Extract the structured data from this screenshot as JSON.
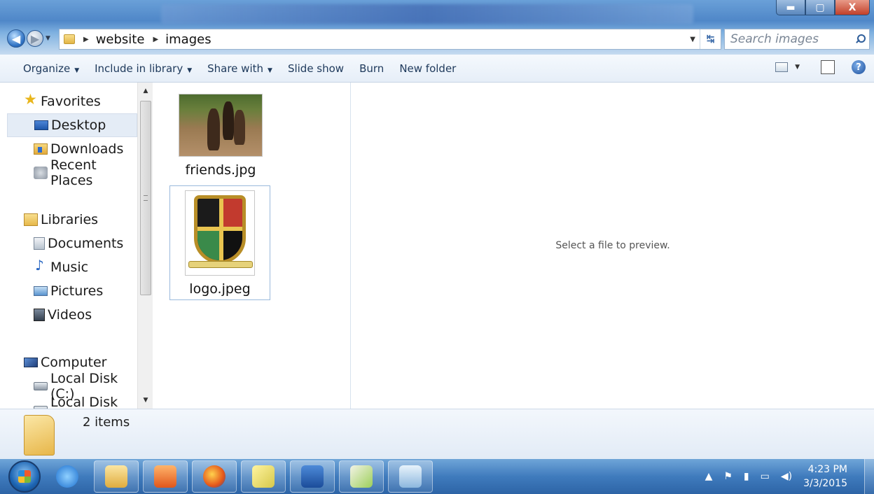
{
  "window": {
    "minimize_icon": "minimize-icon",
    "maximize_icon": "maximize-icon",
    "close_label": "X"
  },
  "address": {
    "breadcrumbs": [
      "website",
      "images"
    ]
  },
  "search": {
    "placeholder": "Search images"
  },
  "toolbar": {
    "organize": "Organize",
    "include_in_library": "Include in library",
    "share_with": "Share with",
    "slide_show": "Slide show",
    "burn": "Burn",
    "new_folder": "New folder",
    "help_label": "?"
  },
  "nav": {
    "favorites": "Favorites",
    "desktop": "Desktop",
    "downloads": "Downloads",
    "recent_places": "Recent Places",
    "libraries": "Libraries",
    "documents": "Documents",
    "music": "Music",
    "pictures": "Pictures",
    "videos": "Videos",
    "computer": "Computer",
    "local_disk_c": "Local Disk (C:)",
    "local_disk_d": "Local Disk (D:)"
  },
  "files": [
    {
      "name": "friends.jpg",
      "selected": false
    },
    {
      "name": "logo.jpeg",
      "selected": true
    }
  ],
  "preview": {
    "message": "Select a file to preview."
  },
  "details": {
    "item_count": "2 items"
  },
  "taskbar": {
    "apps": [
      "internet-explorer",
      "windows-explorer",
      "media-player",
      "firefox",
      "sticky-notes",
      "microsoft-word",
      "paint",
      "notepad"
    ],
    "time": "4:23 PM",
    "date": "3/3/2015"
  },
  "colors": {
    "title_bar": "#4f87c8",
    "command_bar": "#e6eef8",
    "taskbar": "#3f7bbd",
    "selection": "#e4ecf6"
  }
}
